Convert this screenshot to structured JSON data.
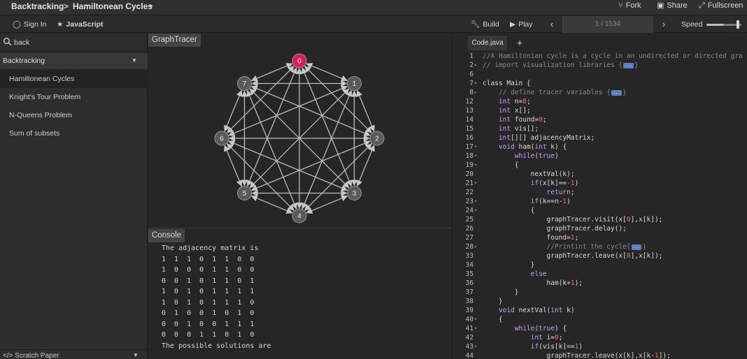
{
  "topbar": {
    "breadcrumb_category": "Backtracking",
    "breadcrumb_separator": ">",
    "breadcrumb_algorithm": "Hamiltonean Cycles",
    "fork_label": "Fork",
    "share_label": "Share",
    "fullscreen_label": "Fullscreen"
  },
  "toolbar": {
    "signin_label": "Sign In",
    "language_label": "JavaScript",
    "build_label": "Build",
    "play_label": "Play",
    "progress_text": "1 / 1534",
    "progress_current": 1,
    "progress_total": 1534,
    "speed_label": "Speed",
    "speed_level": 0.5
  },
  "sidebar": {
    "search_value": "back",
    "category_label": "Backtracking",
    "items": [
      {
        "label": "Hamiltonean Cycles",
        "active": true
      },
      {
        "label": "Knight's Tour Problem",
        "active": false
      },
      {
        "label": "N-Queens Problem",
        "active": false
      },
      {
        "label": "Sum of subsets",
        "active": false
      }
    ],
    "scratch_label": "Scratch Paper"
  },
  "graph_panel": {
    "tab_label": "GraphTracer",
    "nodes": [
      "0",
      "1",
      "2",
      "3",
      "4",
      "5",
      "6",
      "7"
    ],
    "highlight_node": 0,
    "colors": {
      "node": "#5a5a5a",
      "highlight": "#d81b60",
      "edge": "#bdbdbd"
    }
  },
  "console": {
    "tab_label": "Console",
    "lines": [
      "The adjacency matrix is",
      "1  1  1  0  1  1  0  0",
      "1  0  0  0  1  1  0  0",
      "0  0  1  0  1  1  0  1",
      "1  0  1  0  1  1  1  1",
      "1  0  1  0  1  1  1  0",
      "0  1  0  0  1  0  1  0",
      "0  0  1  0  0  1  1  1",
      "0  0  0  1  1  0  1  0",
      "The possible solutions are"
    ]
  },
  "editor": {
    "tab_label": "Code.java",
    "add_tab_label": "+",
    "fold_badge": "...",
    "lines": [
      {
        "n": "1",
        "fold": "",
        "segs": [
          {
            "t": "//A Hamiltonian cycle is a cycle in an undirected or directed gra",
            "c": "cmt"
          }
        ]
      },
      {
        "n": "2",
        "fold": "▸",
        "segs": [
          {
            "t": "// import visualization libraries {",
            "c": "cmt"
          },
          {
            "b": true
          },
          {
            "t": "}",
            "c": "cmt"
          }
        ]
      },
      {
        "n": "6",
        "fold": "",
        "segs": []
      },
      {
        "n": "7",
        "fold": "▾",
        "segs": [
          {
            "t": "class Main {"
          }
        ]
      },
      {
        "n": "8",
        "fold": "▸",
        "segs": [
          {
            "t": "    // define tracer variables {",
            "c": "cmt"
          },
          {
            "b": true
          },
          {
            "t": "}",
            "c": "cmt"
          }
        ]
      },
      {
        "n": "12",
        "fold": "",
        "segs": [
          {
            "t": "    "
          },
          {
            "t": "int",
            "c": "kw"
          },
          {
            "t": " n="
          },
          {
            "t": "8",
            "c": "num"
          },
          {
            "t": ";"
          }
        ]
      },
      {
        "n": "13",
        "fold": "",
        "segs": [
          {
            "t": "    "
          },
          {
            "t": "int",
            "c": "kw"
          },
          {
            "t": " x[];"
          }
        ]
      },
      {
        "n": "14",
        "fold": "",
        "segs": [
          {
            "t": "    "
          },
          {
            "t": "int",
            "c": "kw"
          },
          {
            "t": " found="
          },
          {
            "t": "0",
            "c": "num"
          },
          {
            "t": ";"
          }
        ]
      },
      {
        "n": "15",
        "fold": "",
        "segs": [
          {
            "t": "    "
          },
          {
            "t": "int",
            "c": "kw"
          },
          {
            "t": " vis[];"
          }
        ]
      },
      {
        "n": "16",
        "fold": "",
        "segs": [
          {
            "t": "    "
          },
          {
            "t": "int",
            "c": "kw"
          },
          {
            "t": "[][] adjacencyMatrix;"
          }
        ]
      },
      {
        "n": "17",
        "fold": "▾",
        "segs": [
          {
            "t": "    "
          },
          {
            "t": "void",
            "c": "kw"
          },
          {
            "t": " ham("
          },
          {
            "t": "int",
            "c": "kw"
          },
          {
            "t": " k) {"
          }
        ]
      },
      {
        "n": "18",
        "fold": "▾",
        "segs": [
          {
            "t": "        "
          },
          {
            "t": "while",
            "c": "kw"
          },
          {
            "t": "("
          },
          {
            "t": "true",
            "c": "kw"
          },
          {
            "t": ")"
          }
        ]
      },
      {
        "n": "19",
        "fold": "▾",
        "segs": [
          {
            "t": "        {"
          }
        ]
      },
      {
        "n": "20",
        "fold": "",
        "segs": [
          {
            "t": "            nextVal(k);"
          }
        ]
      },
      {
        "n": "21",
        "fold": "▾",
        "segs": [
          {
            "t": "            "
          },
          {
            "t": "if",
            "c": "kw"
          },
          {
            "t": "(x[k]=="
          },
          {
            "t": "-1",
            "c": "num"
          },
          {
            "t": ")"
          }
        ]
      },
      {
        "n": "22",
        "fold": "",
        "segs": [
          {
            "t": "                "
          },
          {
            "t": "return",
            "c": "kw"
          },
          {
            "t": ";"
          }
        ]
      },
      {
        "n": "23",
        "fold": "▾",
        "segs": [
          {
            "t": "            "
          },
          {
            "t": "if",
            "c": "kw"
          },
          {
            "t": "(k==n-"
          },
          {
            "t": "1",
            "c": "num"
          },
          {
            "t": ")"
          }
        ]
      },
      {
        "n": "24",
        "fold": "▾",
        "segs": [
          {
            "t": "            {"
          }
        ]
      },
      {
        "n": "25",
        "fold": "",
        "segs": [
          {
            "t": "                graphTracer.visit(x["
          },
          {
            "t": "0",
            "c": "num"
          },
          {
            "t": "],x[k]);"
          }
        ]
      },
      {
        "n": "26",
        "fold": "",
        "segs": [
          {
            "t": "                graphTracer.delay();"
          }
        ]
      },
      {
        "n": "27",
        "fold": "",
        "segs": [
          {
            "t": "                found="
          },
          {
            "t": "1",
            "c": "num"
          },
          {
            "t": ";"
          }
        ]
      },
      {
        "n": "28",
        "fold": "▸",
        "segs": [
          {
            "t": "                //Printint the cycle{",
            "c": "cmt"
          },
          {
            "b": true
          },
          {
            "t": "}",
            "c": "cmt"
          }
        ]
      },
      {
        "n": "33",
        "fold": "",
        "segs": [
          {
            "t": "                graphTracer.leave(x["
          },
          {
            "t": "0",
            "c": "num"
          },
          {
            "t": "],x[k]);"
          }
        ]
      },
      {
        "n": "34",
        "fold": "",
        "segs": [
          {
            "t": "            }"
          }
        ]
      },
      {
        "n": "35",
        "fold": "",
        "segs": [
          {
            "t": "            "
          },
          {
            "t": "else",
            "c": "kw"
          }
        ]
      },
      {
        "n": "36",
        "fold": "",
        "segs": [
          {
            "t": "                ham(k+"
          },
          {
            "t": "1",
            "c": "num"
          },
          {
            "t": ");"
          }
        ]
      },
      {
        "n": "37",
        "fold": "",
        "segs": [
          {
            "t": "        }"
          }
        ]
      },
      {
        "n": "38",
        "fold": "",
        "segs": [
          {
            "t": "    }"
          }
        ]
      },
      {
        "n": "39",
        "fold": "",
        "segs": [
          {
            "t": "    "
          },
          {
            "t": "void",
            "c": "kw"
          },
          {
            "t": " nextVal("
          },
          {
            "t": "int",
            "c": "kw"
          },
          {
            "t": " k)"
          }
        ]
      },
      {
        "n": "40",
        "fold": "▾",
        "segs": [
          {
            "t": "    {"
          }
        ]
      },
      {
        "n": "41",
        "fold": "▾",
        "segs": [
          {
            "t": "        "
          },
          {
            "t": "while",
            "c": "kw"
          },
          {
            "t": "("
          },
          {
            "t": "true",
            "c": "kw"
          },
          {
            "t": ") {"
          }
        ]
      },
      {
        "n": "42",
        "fold": "",
        "segs": [
          {
            "t": "            "
          },
          {
            "t": "int",
            "c": "kw"
          },
          {
            "t": " i="
          },
          {
            "t": "0",
            "c": "num"
          },
          {
            "t": ";"
          }
        ]
      },
      {
        "n": "43",
        "fold": "▾",
        "segs": [
          {
            "t": "            "
          },
          {
            "t": "if",
            "c": "kw"
          },
          {
            "t": "(vis[k]=="
          },
          {
            "t": "1",
            "c": "num"
          },
          {
            "t": ")"
          }
        ]
      },
      {
        "n": "44",
        "fold": "",
        "segs": [
          {
            "t": "                graphTracer.leave(x[k],x[k-"
          },
          {
            "t": "1",
            "c": "num"
          },
          {
            "t": "]);"
          }
        ]
      }
    ]
  }
}
